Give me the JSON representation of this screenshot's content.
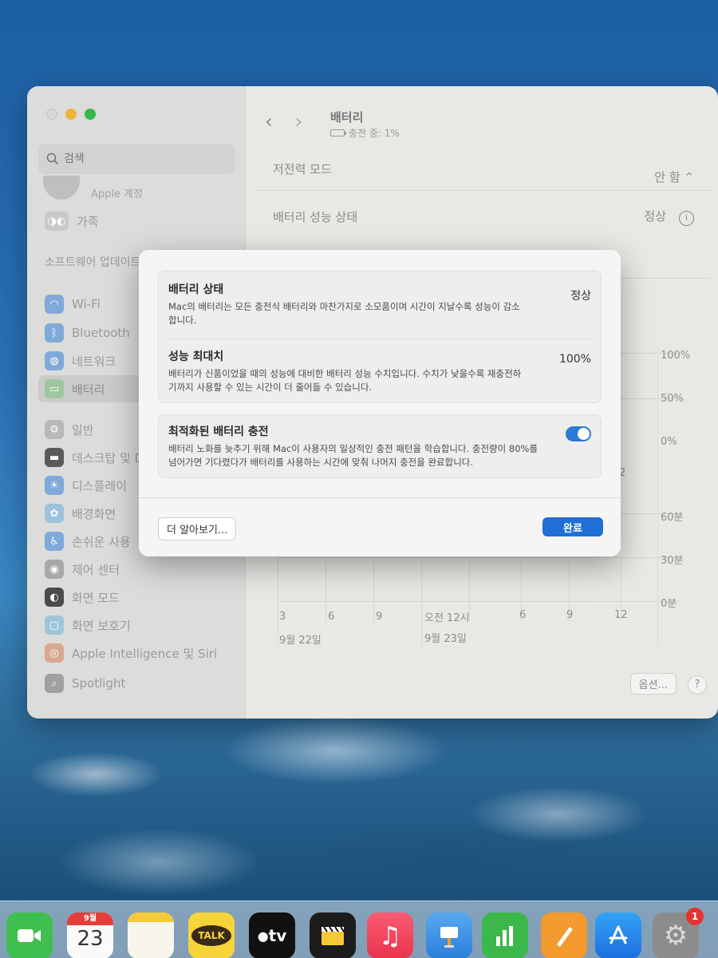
{
  "sidebar": {
    "search_placeholder": "검색",
    "apple_account_label": "Apple 계정",
    "items": [
      {
        "label": "가족",
        "icon": "family-icon"
      },
      {
        "label": "소프트웨어 업데이트",
        "icon": "none"
      },
      {
        "label": "Wi-Fi",
        "icon": "wifi-icon"
      },
      {
        "label": "Bluetooth",
        "icon": "bluetooth-icon"
      },
      {
        "label": "네트워크",
        "icon": "globe-icon"
      },
      {
        "label": "배터리",
        "icon": "battery-icon"
      },
      {
        "label": "일반",
        "icon": "gear-icon"
      },
      {
        "label": "데스크탑 및 Dock",
        "icon": "dock-icon"
      },
      {
        "label": "디스플레이",
        "icon": "sun-icon"
      },
      {
        "label": "배경화면",
        "icon": "flower-icon"
      },
      {
        "label": "손쉬운 사용",
        "icon": "accessibility-icon"
      },
      {
        "label": "제어 센터",
        "icon": "toggle-icon"
      },
      {
        "label": "화면 모드",
        "icon": "appearance-icon"
      },
      {
        "label": "화면 보호기",
        "icon": "screensaver-icon"
      },
      {
        "label": "Apple Intelligence 및 Siri",
        "icon": "siri-icon"
      },
      {
        "label": "Spotlight",
        "icon": "search-icon"
      }
    ]
  },
  "main": {
    "title": "배터리",
    "subtitle": "충전 중: 1%",
    "low_power_label": "저전력 모드",
    "low_power_value": "안 함",
    "health_label": "배터리 성능 상태",
    "health_value": "정상",
    "chart_percent_labels": [
      "100%",
      "50%",
      "0%"
    ],
    "chart_minute_labels": [
      "60분",
      "30분",
      "0분"
    ],
    "chart_x_labels": [
      "3",
      "6",
      "9",
      "오전 12시",
      "6",
      "9",
      "12"
    ],
    "chart_date_labels": [
      "9월 22일",
      "9월 23일"
    ],
    "chart_partial_label": "2",
    "options_button": "옵션...",
    "help_button": "?"
  },
  "dialog": {
    "battery_status_title": "배터리 상태",
    "battery_status_desc": "Mac의 배터리는 모든 충전식 배터리와 마찬가지로 소모품이며 시간이 지날수록 성능이 감소합니다.",
    "battery_status_value": "정상",
    "max_capacity_title": "성능 최대치",
    "max_capacity_desc": "배터리가 신품이었을 때의 성능에 대비한 배터리 성능 수치입니다. 수치가 낮을수록 재충전하기까지 사용할 수 있는 시간이 더 줄어들 수 있습니다.",
    "max_capacity_value": "100%",
    "optimized_title": "최적화된 배터리 충전",
    "optimized_desc": "배터리 노화를 늦추기 위해 Mac이 사용자의 일상적인 충전 패턴을 학습합니다. 충전량이 80%를 넘어가면 기다렸다가 배터리를 사용하는 시간에 맞춰 나머지 충전을 완료합니다.",
    "optimized_enabled": true,
    "learn_more_button": "더 알아보기...",
    "done_button": "완료"
  },
  "dock": {
    "calendar_month": "9월",
    "calendar_day": "23",
    "talk_label": "TALK",
    "tv_label": "tv",
    "settings_badge": "1",
    "apps": [
      "facetime-icon",
      "calendar-icon",
      "notes-icon",
      "kakaotalk-icon",
      "appletv-icon",
      "claquette-icon",
      "music-icon",
      "keynote-icon",
      "numbers-icon",
      "pages-icon",
      "appstore-icon",
      "system-settings-icon"
    ]
  }
}
